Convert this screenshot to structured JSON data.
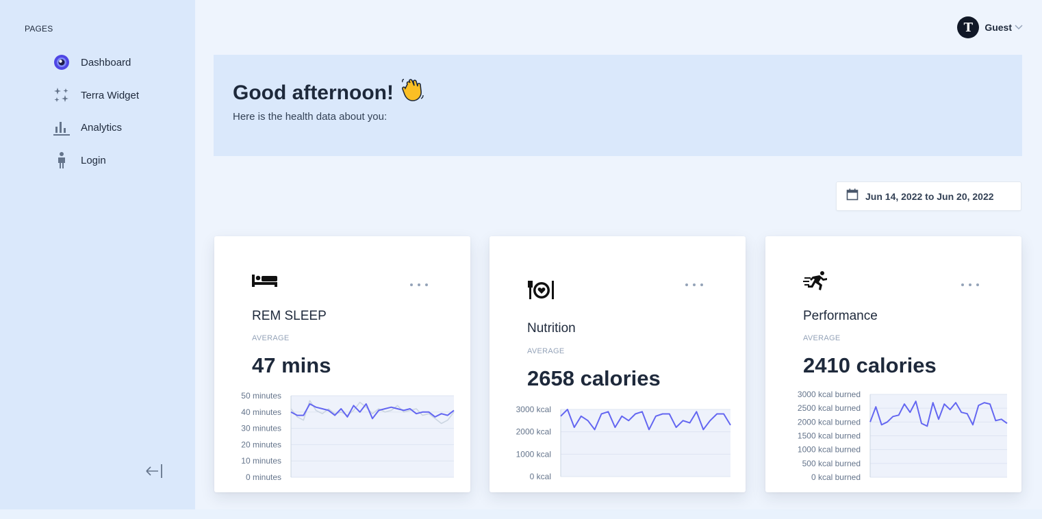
{
  "sidebar": {
    "section_title": "PAGES",
    "items": [
      {
        "label": "Dashboard",
        "icon": "dashboard-icon"
      },
      {
        "label": "Terra Widget",
        "icon": "sparkles-icon"
      },
      {
        "label": "Analytics",
        "icon": "bar-chart-icon"
      },
      {
        "label": "Login",
        "icon": "person-icon"
      }
    ],
    "collapse_icon": "collapse-arrow-icon"
  },
  "header": {
    "user_initial": "T",
    "user_name": "Guest"
  },
  "banner": {
    "greeting": "Good afternoon!",
    "subtitle": "Here is the health data about you:"
  },
  "date_range": {
    "label": "Jun 14, 2022 to Jun 20, 2022"
  },
  "colors": {
    "accent": "#6366f1",
    "sidebar_bg": "#dae8fb",
    "page_bg": "#eef4fd"
  },
  "cards": [
    {
      "icon": "bed-icon",
      "title": "REM SLEEP",
      "avg_label": "AVERAGE",
      "value": "47 mins",
      "chart_data": {
        "type": "line",
        "y_ticks": [
          "50 minutes",
          "40 minutes",
          "30 minutes",
          "20 minutes",
          "10 minutes",
          "0 minutes"
        ],
        "ylim": [
          0,
          50
        ],
        "grid": true,
        "series": [
          {
            "color": "#6366f1",
            "values": [
              40,
              38,
              38,
              45,
              43,
              42,
              41,
              38,
              42,
              37,
              44,
              40,
              45,
              36,
              41,
              42,
              43,
              42,
              41,
              42,
              39,
              40,
              40,
              37,
              39,
              38,
              41
            ]
          },
          {
            "color": "#cbd5e1",
            "values": [
              42,
              37,
              35,
              47,
              41,
              39,
              42,
              39,
              40,
              38,
              41,
              46,
              43,
              39,
              42,
              40,
              41,
              44,
              40,
              41,
              42,
              38,
              39,
              36,
              33,
              35,
              40
            ]
          }
        ]
      }
    },
    {
      "icon": "nutrition-icon",
      "title": "Nutrition",
      "avg_label": "AVERAGE",
      "value": "2658 calories",
      "chart_data": {
        "type": "line",
        "y_ticks": [
          "3000 kcal",
          "2000 kcal",
          "1000 kcal",
          "0 kcal"
        ],
        "ylim": [
          0,
          3000
        ],
        "grid": true,
        "series": [
          {
            "color": "#6366f1",
            "values": [
              2700,
              3000,
              2200,
              2700,
              2500,
              2100,
              2800,
              2900,
              2200,
              2700,
              2500,
              2800,
              2900,
              2100,
              2700,
              2800,
              2800,
              2200,
              2500,
              2400,
              2900,
              2100,
              2500,
              2800,
              2800,
              2300
            ]
          }
        ]
      }
    },
    {
      "icon": "running-icon",
      "title": "Performance",
      "avg_label": "AVERAGE",
      "value": "2410 calories",
      "chart_data": {
        "type": "line",
        "y_ticks": [
          "3000 kcal burned",
          "2500 kcal burned",
          "2000 kcal burned",
          "1500 kcal burned",
          "1000 kcal burned",
          "500 kcal burned",
          "0 kcal burned"
        ],
        "ylim": [
          0,
          3000
        ],
        "grid": true,
        "series": [
          {
            "color": "#6366f1",
            "values": [
              2000,
              2550,
              1900,
              2000,
              2200,
              2250,
              2650,
              2350,
              2750,
              1950,
              1850,
              2700,
              2100,
              2650,
              2450,
              2700,
              2350,
              2300,
              1900,
              2600,
              2700,
              2650,
              2050,
              2100,
              1950
            ]
          }
        ]
      }
    }
  ]
}
